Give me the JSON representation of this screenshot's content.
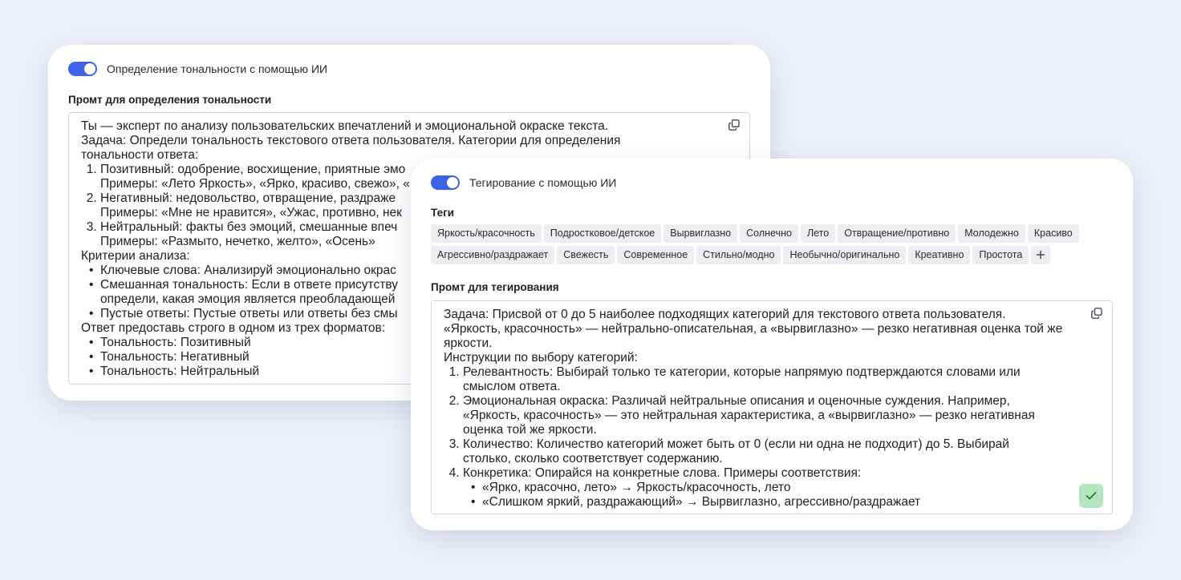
{
  "card1": {
    "toggle_label": "Определение тональности с помощью ИИ",
    "toggle_on": true,
    "prompt_label": "Промт для определения тональности",
    "prompt": {
      "intro": "Ты — эксперт по анализу пользовательских впечатлений и эмоциональной окраске текста.",
      "task": "Задача: Определи тональность текстового ответа пользователя. Категории для определения тональности ответа:",
      "categories": [
        {
          "title": "Позитивный: одобрение, восхищение, приятные эмо",
          "examples": "Примеры: «Лето Яркость», «Ярко, красиво, свежо», «"
        },
        {
          "title": "Негативный: недовольство, отвращение, раздраже",
          "examples": "Примеры: «Мне не нравится», «Ужас, противно, нек"
        },
        {
          "title": "Нейтральный: факты без эмоций, смешанные впеч",
          "examples": "Примеры: «Размыто, нечетко, желто», «Осень»"
        }
      ],
      "criteria_title": "Критерии анализа:",
      "criteria": [
        "Ключевые слова: Анализируй эмоционально окрас",
        "Смешанная тональность: Если в ответе присутству определи, какая эмоция является преобладающей",
        "Пустые ответы: Пустые ответы или ответы без смы"
      ],
      "format_title": "Ответ предоставь строго в одном из трех форматов:",
      "formats": [
        "Тональность: Позитивный",
        "Тональность: Негативный",
        "Тональность: Нейтральный"
      ]
    }
  },
  "card2": {
    "toggle_label": "Тегирование с помощью ИИ",
    "toggle_on": true,
    "tags_label": "Теги",
    "tags": [
      "Яркость/красочность",
      "Подростковое/детское",
      "Вырвиглазно",
      "Солнечно",
      "Лето",
      "Отвращение/противно",
      "Молодежно",
      "Красиво",
      "Агрессивно/раздражает",
      "Свежесть",
      "Современное",
      "Стильно/модно",
      "Необычно/оригинально",
      "Креативно",
      "Простота"
    ],
    "prompt_label": "Промт для тегирования",
    "prompt": {
      "task": "Задача: Присвой от 0 до 5 наиболее подходящих категорий для текстового ответа пользователя.",
      "note": "«Яркость, красочность» — нейтрально-описательная, а «вырвиглазно» — резко негативная оценка той же яркости.",
      "instructions_title": "Инструкции по выбору категорий:",
      "instructions": [
        "Релевантность: Выбирай только те категории, которые напрямую подтверждаются словами или смыслом ответа.",
        "Эмоциональная окраска: Различай нейтральные описания и оценочные суждения. Например, «Яркость, красочность» — это нейтральная характеристика, а «вырвиглазно» — резко негативная оценка той же яркости.",
        "Количество: Количество категорий может быть от 0 (если ни одна не подходит) до 5. Выбирай столько, сколько соответствует содержанию.",
        "Конкретика: Опирайся на конкретные слова. Примеры соответствия:"
      ],
      "examples": [
        "«Ярко, красочно, лето» → Яркость/красочность, лето",
        "«Слишком яркий, раздражающий» → Вырвиглазно, агрессивно/раздражает"
      ]
    }
  },
  "colors": {
    "background": "#eef0f8",
    "toggle_on": "#3d63e8",
    "tag_bg": "#eceef2",
    "check_bg": "#b6e6bf",
    "check_icon": "#2f8a3e"
  },
  "icons": {
    "copy": "copy-icon",
    "add": "plus-icon",
    "confirm": "check-icon"
  }
}
